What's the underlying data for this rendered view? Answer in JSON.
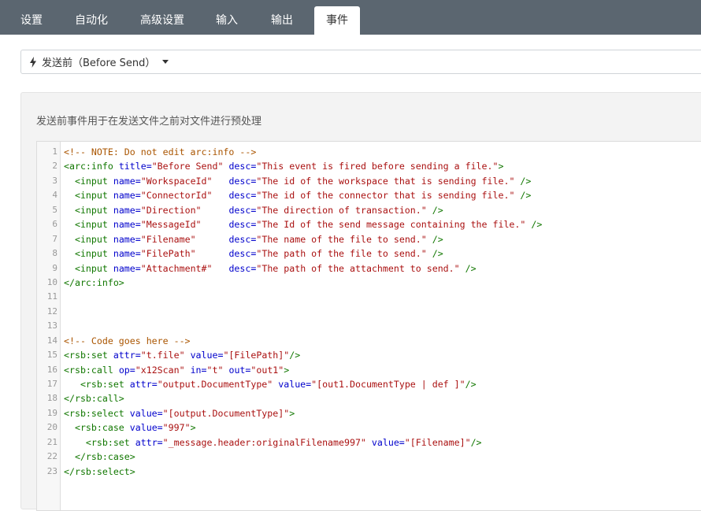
{
  "tabs": [
    {
      "label": "设置"
    },
    {
      "label": "自动化"
    },
    {
      "label": "高级设置"
    },
    {
      "label": "输入"
    },
    {
      "label": "输出"
    },
    {
      "label": "事件"
    }
  ],
  "event_select": {
    "label": "发送前（Before Send）",
    "icon": "lightning-bolt-icon"
  },
  "description": "发送前事件用于在发送文件之前对文件进行预处理",
  "editor": {
    "lines": [
      {
        "n": "1",
        "segs": [
          [
            "cmt",
            "<!-- NOTE: Do not edit arc:info -->"
          ]
        ]
      },
      {
        "n": "2",
        "segs": [
          [
            "tag",
            "<arc:info"
          ],
          [
            "plain",
            " "
          ],
          [
            "attr",
            "title="
          ],
          [
            "str",
            "\"Before Send\""
          ],
          [
            "plain",
            " "
          ],
          [
            "attr",
            "desc="
          ],
          [
            "str",
            "\"This event is fired before sending a file.\""
          ],
          [
            "tag",
            ">"
          ]
        ]
      },
      {
        "n": "3",
        "segs": [
          [
            "plain",
            "  "
          ],
          [
            "tag",
            "<input"
          ],
          [
            "plain",
            " "
          ],
          [
            "attr",
            "name="
          ],
          [
            "str",
            "\"WorkspaceId\""
          ],
          [
            "plain",
            "   "
          ],
          [
            "attr",
            "desc="
          ],
          [
            "str",
            "\"The id of the workspace that is sending file.\""
          ],
          [
            "plain",
            " "
          ],
          [
            "tag",
            "/>"
          ]
        ]
      },
      {
        "n": "4",
        "segs": [
          [
            "plain",
            "  "
          ],
          [
            "tag",
            "<input"
          ],
          [
            "plain",
            " "
          ],
          [
            "attr",
            "name="
          ],
          [
            "str",
            "\"ConnectorId\""
          ],
          [
            "plain",
            "   "
          ],
          [
            "attr",
            "desc="
          ],
          [
            "str",
            "\"The id of the connector that is sending file.\""
          ],
          [
            "plain",
            " "
          ],
          [
            "tag",
            "/>"
          ]
        ]
      },
      {
        "n": "5",
        "segs": [
          [
            "plain",
            "  "
          ],
          [
            "tag",
            "<input"
          ],
          [
            "plain",
            " "
          ],
          [
            "attr",
            "name="
          ],
          [
            "str",
            "\"Direction\""
          ],
          [
            "plain",
            "     "
          ],
          [
            "attr",
            "desc="
          ],
          [
            "str",
            "\"The direction of transaction.\""
          ],
          [
            "plain",
            " "
          ],
          [
            "tag",
            "/>"
          ]
        ]
      },
      {
        "n": "6",
        "segs": [
          [
            "plain",
            "  "
          ],
          [
            "tag",
            "<input"
          ],
          [
            "plain",
            " "
          ],
          [
            "attr",
            "name="
          ],
          [
            "str",
            "\"MessageId\""
          ],
          [
            "plain",
            "     "
          ],
          [
            "attr",
            "desc="
          ],
          [
            "str",
            "\"The Id of the send message containing the file.\""
          ],
          [
            "plain",
            " "
          ],
          [
            "tag",
            "/>"
          ]
        ]
      },
      {
        "n": "7",
        "segs": [
          [
            "plain",
            "  "
          ],
          [
            "tag",
            "<input"
          ],
          [
            "plain",
            " "
          ],
          [
            "attr",
            "name="
          ],
          [
            "str",
            "\"Filename\""
          ],
          [
            "plain",
            "      "
          ],
          [
            "attr",
            "desc="
          ],
          [
            "str",
            "\"The name of the file to send.\""
          ],
          [
            "plain",
            " "
          ],
          [
            "tag",
            "/>"
          ]
        ]
      },
      {
        "n": "8",
        "segs": [
          [
            "plain",
            "  "
          ],
          [
            "tag",
            "<input"
          ],
          [
            "plain",
            " "
          ],
          [
            "attr",
            "name="
          ],
          [
            "str",
            "\"FilePath\""
          ],
          [
            "plain",
            "      "
          ],
          [
            "attr",
            "desc="
          ],
          [
            "str",
            "\"The path of the file to send.\""
          ],
          [
            "plain",
            " "
          ],
          [
            "tag",
            "/>"
          ]
        ]
      },
      {
        "n": "9",
        "segs": [
          [
            "plain",
            "  "
          ],
          [
            "tag",
            "<input"
          ],
          [
            "plain",
            " "
          ],
          [
            "attr",
            "name="
          ],
          [
            "str",
            "\"Attachment#\""
          ],
          [
            "plain",
            "   "
          ],
          [
            "attr",
            "desc="
          ],
          [
            "str",
            "\"The path of the attachment to send.\""
          ],
          [
            "plain",
            " "
          ],
          [
            "tag",
            "/>"
          ]
        ]
      },
      {
        "n": "10",
        "segs": [
          [
            "tag",
            "</arc:info>"
          ]
        ]
      },
      {
        "n": "11",
        "segs": []
      },
      {
        "n": "12",
        "segs": []
      },
      {
        "n": "13",
        "segs": []
      },
      {
        "n": "14",
        "segs": [
          [
            "cmt",
            "<!-- Code goes here -->"
          ]
        ]
      },
      {
        "n": "15",
        "segs": [
          [
            "tag",
            "<rsb:set"
          ],
          [
            "plain",
            " "
          ],
          [
            "attr",
            "attr="
          ],
          [
            "str",
            "\"t.file\""
          ],
          [
            "plain",
            " "
          ],
          [
            "attr",
            "value="
          ],
          [
            "str",
            "\"[FilePath]\""
          ],
          [
            "tag",
            "/>"
          ]
        ]
      },
      {
        "n": "16",
        "segs": [
          [
            "tag",
            "<rsb:call"
          ],
          [
            "plain",
            " "
          ],
          [
            "attr",
            "op="
          ],
          [
            "str",
            "\"x12Scan\""
          ],
          [
            "plain",
            " "
          ],
          [
            "attr",
            "in="
          ],
          [
            "str",
            "\"t\""
          ],
          [
            "plain",
            " "
          ],
          [
            "attr",
            "out="
          ],
          [
            "str",
            "\"out1\""
          ],
          [
            "tag",
            ">"
          ]
        ]
      },
      {
        "n": "17",
        "segs": [
          [
            "plain",
            "   "
          ],
          [
            "tag",
            "<rsb:set"
          ],
          [
            "plain",
            " "
          ],
          [
            "attr",
            "attr="
          ],
          [
            "str",
            "\"output.DocumentType\""
          ],
          [
            "plain",
            " "
          ],
          [
            "attr",
            "value="
          ],
          [
            "str",
            "\"[out1.DocumentType | def ]\""
          ],
          [
            "tag",
            "/>"
          ]
        ]
      },
      {
        "n": "18",
        "segs": [
          [
            "tag",
            "</rsb:call>"
          ]
        ]
      },
      {
        "n": "19",
        "segs": [
          [
            "tag",
            "<rsb:select"
          ],
          [
            "plain",
            " "
          ],
          [
            "attr",
            "value="
          ],
          [
            "str",
            "\"[output.DocumentType]\""
          ],
          [
            "tag",
            ">"
          ]
        ]
      },
      {
        "n": "20",
        "segs": [
          [
            "plain",
            "  "
          ],
          [
            "tag",
            "<rsb:case"
          ],
          [
            "plain",
            " "
          ],
          [
            "attr",
            "value="
          ],
          [
            "str",
            "\"997\""
          ],
          [
            "tag",
            ">"
          ]
        ]
      },
      {
        "n": "21",
        "segs": [
          [
            "plain",
            "    "
          ],
          [
            "tag",
            "<rsb:set"
          ],
          [
            "plain",
            " "
          ],
          [
            "attr",
            "attr="
          ],
          [
            "str",
            "\"_message.header:originalFilename997\""
          ],
          [
            "plain",
            " "
          ],
          [
            "attr",
            "value="
          ],
          [
            "str",
            "\"[Filename]\""
          ],
          [
            "tag",
            "/>"
          ]
        ]
      },
      {
        "n": "22",
        "segs": [
          [
            "plain",
            "  "
          ],
          [
            "tag",
            "</rsb:case>"
          ]
        ]
      },
      {
        "n": "23",
        "segs": [
          [
            "tag",
            "</rsb:select>"
          ]
        ]
      }
    ]
  },
  "colors": {
    "tabbar": "#5b6670",
    "tag": "#117700",
    "attr": "#0000cc",
    "string": "#aa1111",
    "comment": "#aa5500"
  }
}
